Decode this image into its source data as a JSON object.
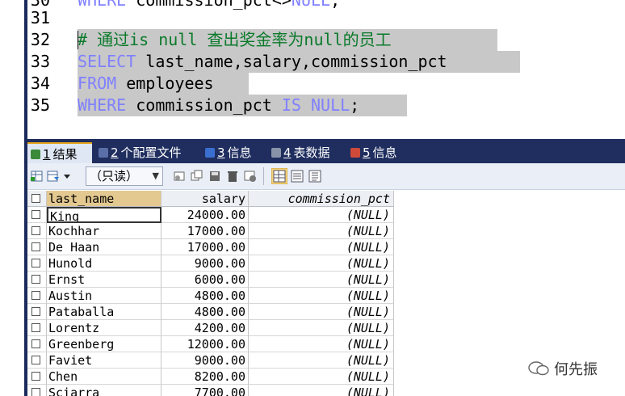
{
  "editor": {
    "lines": [
      {
        "num": "30",
        "parts": [
          {
            "t": "WHERE ",
            "k": "kw"
          },
          {
            "t": "commission_pct<>",
            "k": "tx"
          },
          {
            "t": "NULL",
            "k": "kw"
          },
          {
            "t": ";",
            "k": "tx"
          }
        ]
      },
      {
        "num": "31",
        "parts": []
      },
      {
        "num": "32",
        "parts": [
          {
            "t": "# 通过is null 查出奖金率为null的员工",
            "k": "cm"
          }
        ]
      },
      {
        "num": "33",
        "parts": [
          {
            "t": "SELECT ",
            "k": "kw"
          },
          {
            "t": "last_name,salary,commission_pct",
            "k": "tx"
          }
        ]
      },
      {
        "num": "34",
        "parts": [
          {
            "t": "FROM ",
            "k": "kw"
          },
          {
            "t": "employees",
            "k": "tx"
          }
        ]
      },
      {
        "num": "35",
        "parts": [
          {
            "t": "WHERE ",
            "k": "kw"
          },
          {
            "t": "commission_pct ",
            "k": "tx"
          },
          {
            "t": "IS NULL",
            "k": "kw"
          },
          {
            "t": ";",
            "k": "tx"
          }
        ]
      }
    ]
  },
  "tabs": [
    {
      "num": "1",
      "label": "结果",
      "icon": "grid-result-icon",
      "color": "#3a8a3a"
    },
    {
      "num": "2",
      "label": "个配置文件",
      "icon": "profile-icon",
      "color": "#5a6fa8"
    },
    {
      "num": "3",
      "label": "信息",
      "icon": "info-icon",
      "color": "#3a6fd0"
    },
    {
      "num": "4",
      "label": "表数据",
      "icon": "table-icon",
      "color": "#8a94a8"
    },
    {
      "num": "5",
      "label": "信息",
      "icon": "info2-icon",
      "color": "#d04a3a"
    }
  ],
  "toolbar": {
    "readonly_label": "（只读）"
  },
  "grid": {
    "columns": [
      "last_name",
      "salary",
      "commission_pct"
    ],
    "rows": [
      [
        "King",
        "24000.00",
        "(NULL)"
      ],
      [
        "Kochhar",
        "17000.00",
        "(NULL)"
      ],
      [
        "De Haan",
        "17000.00",
        "(NULL)"
      ],
      [
        "Hunold",
        "9000.00",
        "(NULL)"
      ],
      [
        "Ernst",
        "6000.00",
        "(NULL)"
      ],
      [
        "Austin",
        "4800.00",
        "(NULL)"
      ],
      [
        "Pataballa",
        "4800.00",
        "(NULL)"
      ],
      [
        "Lorentz",
        "4200.00",
        "(NULL)"
      ],
      [
        "Greenberg",
        "12000.00",
        "(NULL)"
      ],
      [
        "Faviet",
        "9000.00",
        "(NULL)"
      ],
      [
        "Chen",
        "8200.00",
        "(NULL)"
      ],
      [
        "Sciarra",
        "7700.00",
        "(NULL)"
      ]
    ]
  },
  "watermark": {
    "text": "何先振"
  }
}
